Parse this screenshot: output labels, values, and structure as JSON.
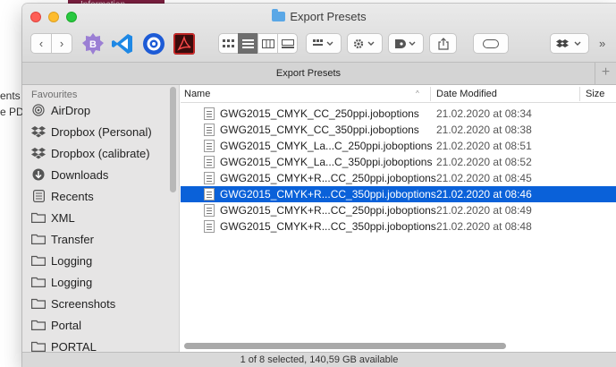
{
  "background": {
    "tab_label": "Information",
    "text_line1": "ents",
    "text_line2": "e PDF"
  },
  "window": {
    "title": "Export Presets",
    "tab_title": "Export Presets",
    "status": "1 of 8 selected, 140,59 GB available"
  },
  "toolbar": {
    "back_glyph": "‹",
    "forward_glyph": "›",
    "overflow_glyph": "»",
    "icons": [
      "back-icon",
      "forward-icon",
      "bbedit-icon",
      "vscode-icon",
      "gear-app-icon",
      "acrobat-icon",
      "icon-view-icon",
      "list-view-icon",
      "column-view-icon",
      "gallery-view-icon",
      "group-by-icon",
      "action-icon",
      "tag-icon",
      "share-icon",
      "edit-tags-icon",
      "dropbox-icon"
    ]
  },
  "sidebar": {
    "heading": "Favourites",
    "items": [
      {
        "label": "AirDrop",
        "icon": "airdrop-icon"
      },
      {
        "label": "Dropbox (Personal)",
        "icon": "dropbox-icon"
      },
      {
        "label": "Dropbox (calibrate)",
        "icon": "dropbox-icon"
      },
      {
        "label": "Downloads",
        "icon": "downloads-icon"
      },
      {
        "label": "Recents",
        "icon": "recents-icon"
      },
      {
        "label": "XML",
        "icon": "folder-icon"
      },
      {
        "label": "Transfer",
        "icon": "folder-icon"
      },
      {
        "label": "Logging",
        "icon": "folder-icon"
      },
      {
        "label": "Logging",
        "icon": "folder-icon"
      },
      {
        "label": "Screenshots",
        "icon": "folder-icon"
      },
      {
        "label": "Portal",
        "icon": "folder-icon"
      },
      {
        "label": "PORTAL",
        "icon": "folder-icon"
      }
    ]
  },
  "columns": {
    "name": "Name",
    "date": "Date Modified",
    "size": "Size",
    "sort_glyph": "^"
  },
  "files": [
    {
      "name": "GWG2015_CMYK_CC_250ppi.joboptions",
      "date": "21.02.2020 at 08:34",
      "selected": false
    },
    {
      "name": "GWG2015_CMYK_CC_350ppi.joboptions",
      "date": "21.02.2020 at 08:38",
      "selected": false
    },
    {
      "name": "GWG2015_CMYK_La...C_250ppi.joboptions",
      "date": "21.02.2020 at 08:51",
      "selected": false
    },
    {
      "name": "GWG2015_CMYK_La...C_350ppi.joboptions",
      "date": "21.02.2020 at 08:52",
      "selected": false
    },
    {
      "name": "GWG2015_CMYK+R...CC_250ppi.joboptions",
      "date": "21.02.2020 at 08:45",
      "selected": false
    },
    {
      "name": "GWG2015_CMYK+R...CC_350ppi.joboptions",
      "date": "21.02.2020 at 08:46",
      "selected": true
    },
    {
      "name": "GWG2015_CMYK+R...CC_250ppi.joboptions",
      "date": "21.02.2020 at 08:49",
      "selected": false
    },
    {
      "name": "GWG2015_CMYK+R...CC_350ppi.joboptions",
      "date": "21.02.2020 at 08:48",
      "selected": false
    }
  ],
  "colors": {
    "selection": "#0a61d9",
    "close": "#fe5f57",
    "minimize": "#febc2e",
    "zoom": "#28c840",
    "folder_accent": "#5aa7e6"
  }
}
